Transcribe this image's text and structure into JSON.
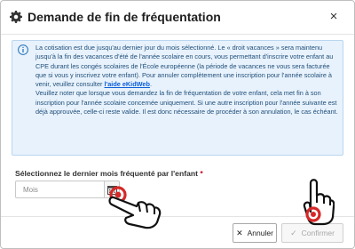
{
  "dialog": {
    "title": "Demande de fin de fréquentation",
    "title_icon": "gear-icon",
    "close_glyph": "×"
  },
  "info": {
    "icon": "info-icon",
    "paragraph1": "La cotisation est due jusqu'au dernier jour du mois sélectionné. Le « droit vacances » sera maintenu jusqu'à la fin des vacances d'été de l'année scolaire en cours, vous permettant d'inscrire votre enfant au CPE durant les congés scolaires de l'École européenne (la période de vacances ne vous sera facturée que si vous y inscrivez votre enfant). Pour annuler complètement une inscription pour l'année scolaire à venir, veuillez consulter ",
    "link_text": "l'aide eKidWeb",
    "paragraph1_end": ".",
    "paragraph2": "Veuillez noter que lorsque vous demandez la fin de fréquentation de votre enfant, cela met fin à son inscription pour l'année scolaire concernée uniquement. Si une autre inscription pour l'année suivante est déjà approuvée, celle-ci reste valide. Il est donc nécessaire de procéder à son annulation, le cas échéant."
  },
  "form": {
    "label": "Sélectionnez le dernier mois fréquenté par l'enfant",
    "required_mark": "*",
    "month_placeholder": "Mois",
    "calendar_icon": "calendar-icon"
  },
  "footer": {
    "cancel_label": "Annuler",
    "confirm_label": "Confirmer",
    "cancel_glyph": "✕",
    "confirm_glyph": "✓"
  },
  "colors": {
    "info_bg": "#e8f2fc",
    "info_text": "#1f4e79",
    "link": "#0b5ed7",
    "required": "#d0021b",
    "click_marker": "#d62828"
  }
}
